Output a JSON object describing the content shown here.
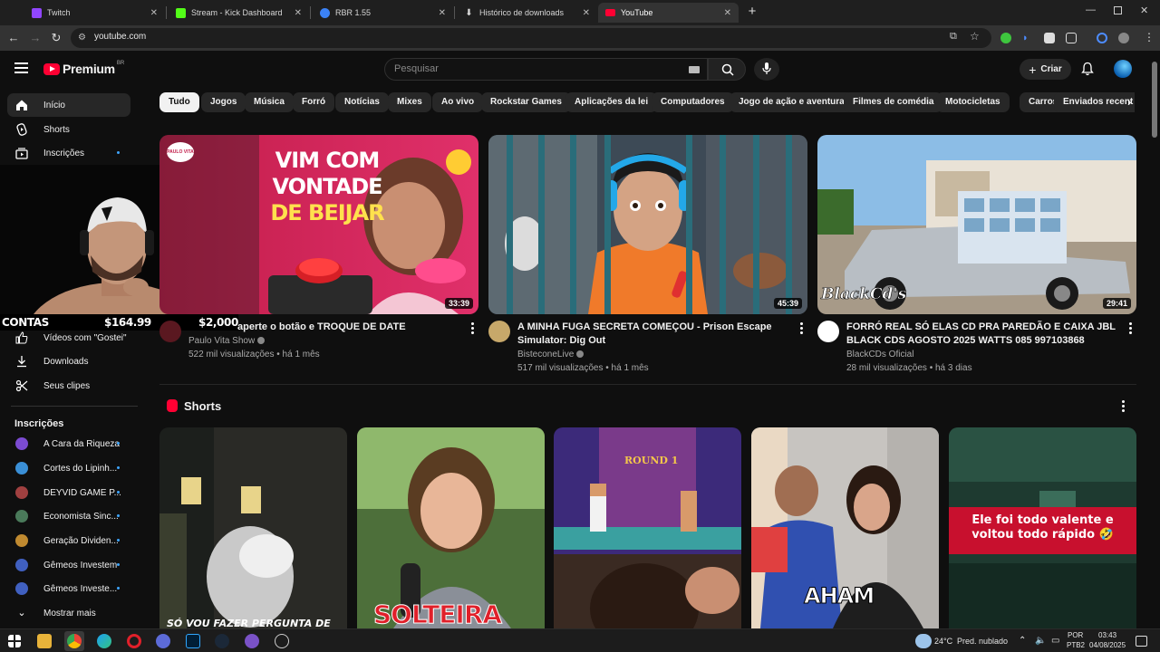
{
  "browser": {
    "tabs": [
      {
        "label": "Twitch",
        "icon": "twitch-icon",
        "color": "#9146ff"
      },
      {
        "label": "Stream - Kick Dashboard",
        "icon": "kick-icon",
        "color": "#53fc18"
      },
      {
        "label": "RBR 1.55",
        "icon": "rbr-icon",
        "color": "#3b82f6"
      },
      {
        "label": "Histórico de downloads",
        "icon": "download-icon",
        "color": "#dddddd"
      },
      {
        "label": "YouTube",
        "icon": "youtube-icon",
        "color": "#ff0033"
      }
    ],
    "url": "youtube.com"
  },
  "youtube": {
    "logo_text": "Premium",
    "logo_country": "BR",
    "search_placeholder": "Pesquisar",
    "create_label": "Criar"
  },
  "sidebar": {
    "main": [
      {
        "label": "Início",
        "icon": "home-icon",
        "active": true
      },
      {
        "label": "Shorts",
        "icon": "shorts-icon"
      },
      {
        "label": "Inscrições",
        "icon": "subscriptions-icon"
      }
    ],
    "you": [
      {
        "label": "Vídeos com \"Gostei\"",
        "icon": "thumbs-up-icon"
      },
      {
        "label": "Downloads",
        "icon": "download-icon"
      },
      {
        "label": "Seus clipes",
        "icon": "scissors-icon"
      }
    ],
    "subs_heading": "Inscrições",
    "subs": [
      {
        "label": "A Cara da Riqueza",
        "color": "#7b4bd1"
      },
      {
        "label": "Cortes do Lipinh...",
        "color": "#3a8fd6"
      },
      {
        "label": "DEYVID GAME P...",
        "color": "#a04040"
      },
      {
        "label": "Economista Sinc...",
        "color": "#4a7a5a"
      },
      {
        "label": "Geração Dividen...",
        "color": "#c08a30"
      },
      {
        "label": "Gêmeos Investem",
        "color": "#4060c0"
      },
      {
        "label": "Gêmeos Investe...",
        "color": "#4060c0"
      }
    ],
    "show_more": "Mostrar mais"
  },
  "overlay": {
    "contas": "CONTAS",
    "amount1": "$164.99",
    "amount2": "$2,000"
  },
  "chips": [
    "Tudo",
    "Jogos",
    "Música",
    "Forró",
    "Notícias",
    "Mixes",
    "Ao vivo",
    "Rockstar Games",
    "Aplicações da lei",
    "Computadores",
    "Jogo de ação e aventura",
    "Filmes de comédia",
    "Motocicletas",
    "Carros",
    "Enviados recent"
  ],
  "videos": [
    {
      "thumb_text": [
        "VIM COM",
        "VONTADE",
        "DE BEIJAR"
      ],
      "thumb_badge": "PAULO VITA",
      "duration": "33:39",
      "title": "aperte o botão e TROQUE DE DATE",
      "channel": "Paulo Vita Show",
      "stats": "522 mil visualizações • há 1 mês"
    },
    {
      "duration": "45:39",
      "title": "A MINHA FUGA SECRETA COMEÇOU - Prison Escape Simulator: Dig Out",
      "channel": "BisteconeLive",
      "stats": "517 mil visualizações • há 1 mês"
    },
    {
      "thumb_logo": "BlackCd's",
      "duration": "29:41",
      "title": "FORRÓ REAL SÓ ELAS CD PRA PAREDÃO E CAIXA JBL BLACK CDS AGOSTO 2025  WATTS 085 997103868",
      "channel": "BlackCDs Oficial",
      "stats": "28 mil visualizações • há 3 dias"
    }
  ],
  "shorts": {
    "heading": "Shorts",
    "items": [
      {
        "caption": "SÓ VOU FAZER PERGUNTA DE"
      },
      {
        "caption": "SOLTEIRA"
      },
      {
        "caption": "ROUND 1"
      },
      {
        "caption": "AHAM"
      },
      {
        "caption": "Ele foi todo valente e voltou todo rápido 🤣"
      }
    ]
  },
  "taskbar": {
    "weather": "24°C",
    "weather_desc": "Pred. nublado",
    "lang1": "POR",
    "lang2": "PTB2",
    "time": "03:43",
    "date": "04/08/2025"
  }
}
